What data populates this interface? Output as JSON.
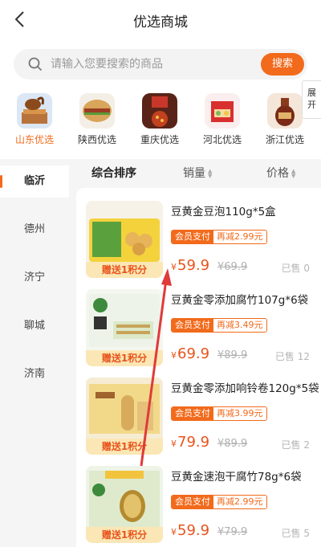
{
  "header": {
    "title": "优选商城"
  },
  "search": {
    "placeholder": "请输入您要搜索的商品",
    "button": "搜索"
  },
  "provinces": [
    {
      "label": "山东优选",
      "active": true
    },
    {
      "label": "陕西优选",
      "active": false
    },
    {
      "label": "重庆优选",
      "active": false
    },
    {
      "label": "河北优选",
      "active": false
    },
    {
      "label": "浙江优选",
      "active": false
    }
  ],
  "expand": {
    "line1": "展",
    "line2": "开"
  },
  "nav": [
    {
      "label": "临沂",
      "active": true
    },
    {
      "label": "德州",
      "active": false
    },
    {
      "label": "济宁",
      "active": false
    },
    {
      "label": "聊城",
      "active": false
    },
    {
      "label": "济南",
      "active": false
    }
  ],
  "sort": {
    "comprehensive": "综合排序",
    "sales": "销量",
    "price": "价格"
  },
  "products": [
    {
      "name": "豆黄金豆泡110g*5盒",
      "tag_a": "会员支付",
      "tag_b": "再减2.99元",
      "price": "59.9",
      "old_price": "¥69.9",
      "sold": "已售 0",
      "gift": "赠送1积分"
    },
    {
      "name": "豆黄金零添加腐竹107g*6袋",
      "tag_a": "会员支付",
      "tag_b": "再减3.49元",
      "price": "69.9",
      "old_price": "¥89.9",
      "sold": "已售 12",
      "gift": "赠送1积分"
    },
    {
      "name": "豆黄金零添加响铃卷120g*5袋",
      "tag_a": "会员支付",
      "tag_b": "再减3.99元",
      "price": "79.9",
      "old_price": "¥89.9",
      "sold": "已售 2",
      "gift": "赠送1积分"
    },
    {
      "name": "豆黄金速泡干腐竹78g*6袋",
      "tag_a": "会员支付",
      "tag_b": "再减2.99元",
      "price": "59.9",
      "old_price": "¥79.9",
      "sold": "已售 5",
      "gift": "赠送1积分"
    }
  ],
  "currency": "¥",
  "colors": {
    "accent": "#f26a1b",
    "price": "#e8541c",
    "annotation_arrow": "#e03a3a"
  },
  "icons": {
    "back": "chevron-left-icon",
    "search": "search-icon"
  }
}
